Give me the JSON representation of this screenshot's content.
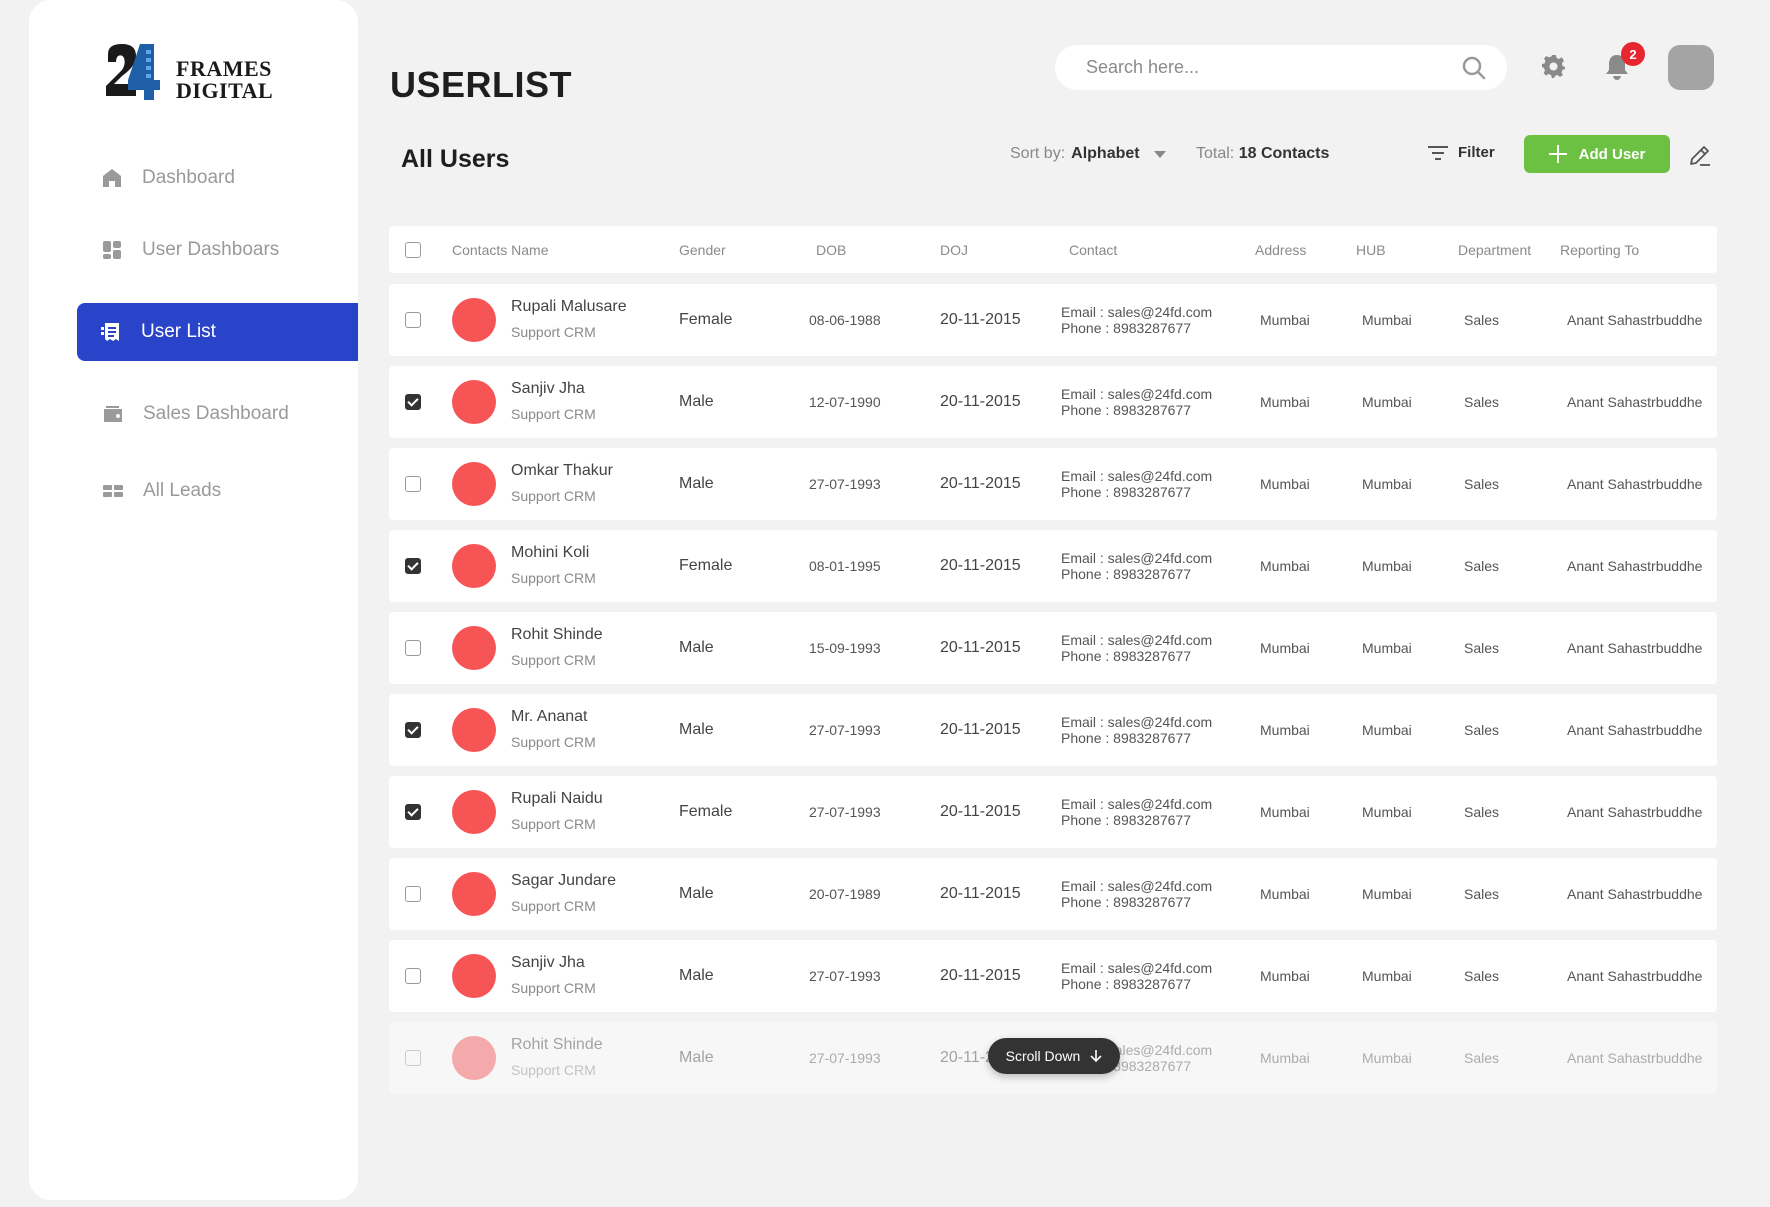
{
  "brand": {
    "line1": "FRAMES",
    "line2": "DIGITAL"
  },
  "sidebar": {
    "items": [
      {
        "label": "Dashboard",
        "icon": "home-icon",
        "active": false
      },
      {
        "label": "User Dashboars",
        "icon": "dashboard-icon",
        "active": false
      },
      {
        "label": "User List",
        "icon": "list-icon",
        "active": true
      },
      {
        "label": "Sales Dashboard",
        "icon": "wallet-icon",
        "active": false
      },
      {
        "label": "All Leads",
        "icon": "leads-icon",
        "active": false
      }
    ]
  },
  "header": {
    "title": "USERLIST",
    "search_placeholder": "Search here...",
    "notification_count": "2"
  },
  "toolbar": {
    "subtitle": "All Users",
    "sort_label": "Sort by:",
    "sort_value": "Alphabet",
    "total_label": "Total:",
    "total_value": "18 Contacts",
    "filter_label": "Filter",
    "add_label": "Add User"
  },
  "table": {
    "headers": [
      "Contacts Name",
      "Gender",
      "DOB",
      "DOJ",
      "Contact",
      "Address",
      "HUB",
      "Department",
      "Reporting To"
    ],
    "rows": [
      {
        "checked": false,
        "name": "Rupali Malusare",
        "role": "Support CRM",
        "gender": "Female",
        "dob": "08-06-1988",
        "doj": "20-11-2015",
        "email": "Email : sales@24fd.com",
        "phone": "Phone : 8983287677",
        "address": "Mumbai",
        "hub": "Mumbai",
        "department": "Sales",
        "reporting": "Anant Sahastrbuddhe"
      },
      {
        "checked": true,
        "name": "Sanjiv Jha",
        "role": "Support CRM",
        "gender": "Male",
        "dob": "12-07-1990",
        "doj": "20-11-2015",
        "email": "Email : sales@24fd.com",
        "phone": "Phone : 8983287677",
        "address": "Mumbai",
        "hub": "Mumbai",
        "department": "Sales",
        "reporting": "Anant Sahastrbuddhe"
      },
      {
        "checked": false,
        "name": "Omkar Thakur",
        "role": "Support CRM",
        "gender": "Male",
        "dob": "27-07-1993",
        "doj": "20-11-2015",
        "email": "Email : sales@24fd.com",
        "phone": "Phone : 8983287677",
        "address": "Mumbai",
        "hub": "Mumbai",
        "department": "Sales",
        "reporting": "Anant Sahastrbuddhe"
      },
      {
        "checked": true,
        "name": "Mohini Koli",
        "role": "Support CRM",
        "gender": "Female",
        "dob": "08-01-1995",
        "doj": "20-11-2015",
        "email": "Email : sales@24fd.com",
        "phone": "Phone : 8983287677",
        "address": "Mumbai",
        "hub": "Mumbai",
        "department": "Sales",
        "reporting": "Anant Sahastrbuddhe"
      },
      {
        "checked": false,
        "name": "Rohit Shinde",
        "role": "Support CRM",
        "gender": "Male",
        "dob": "15-09-1993",
        "doj": "20-11-2015",
        "email": "Email : sales@24fd.com",
        "phone": "Phone : 8983287677",
        "address": "Mumbai",
        "hub": "Mumbai",
        "department": "Sales",
        "reporting": "Anant Sahastrbuddhe"
      },
      {
        "checked": true,
        "name": "Mr. Ananat",
        "role": "Support CRM",
        "gender": "Male",
        "dob": "27-07-1993",
        "doj": "20-11-2015",
        "email": "Email : sales@24fd.com",
        "phone": "Phone : 8983287677",
        "address": "Mumbai",
        "hub": "Mumbai",
        "department": "Sales",
        "reporting": "Anant Sahastrbuddhe"
      },
      {
        "checked": true,
        "name": "Rupali Naidu",
        "role": "Support CRM",
        "gender": "Female",
        "dob": "27-07-1993",
        "doj": "20-11-2015",
        "email": "Email : sales@24fd.com",
        "phone": "Phone : 8983287677",
        "address": "Mumbai",
        "hub": "Mumbai",
        "department": "Sales",
        "reporting": "Anant Sahastrbuddhe"
      },
      {
        "checked": false,
        "name": "Sagar Jundare",
        "role": "Support CRM",
        "gender": "Male",
        "dob": "20-07-1989",
        "doj": "20-11-2015",
        "email": "Email : sales@24fd.com",
        "phone": "Phone : 8983287677",
        "address": "Mumbai",
        "hub": "Mumbai",
        "department": "Sales",
        "reporting": "Anant Sahastrbuddhe"
      },
      {
        "checked": false,
        "name": "Sanjiv Jha",
        "role": "Support CRM",
        "gender": "Male",
        "dob": "27-07-1993",
        "doj": "20-11-2015",
        "email": "Email : sales@24fd.com",
        "phone": "Phone : 8983287677",
        "address": "Mumbai",
        "hub": "Mumbai",
        "department": "Sales",
        "reporting": "Anant Sahastrbuddhe"
      },
      {
        "checked": false,
        "name": "Rohit Shinde",
        "role": "Support CRM",
        "gender": "Male",
        "dob": "27-07-1993",
        "doj": "20-11-2015",
        "email": "Email : sales@24fd.com",
        "phone": "Phone : 8983287677",
        "address": "Mumbai",
        "hub": "Mumbai",
        "department": "Sales",
        "reporting": "Anant Sahastrbuddhe",
        "faded": true
      }
    ]
  },
  "scroll_hint": "Scroll Down",
  "colors": {
    "accent": "#2a44c9",
    "add_button": "#6cc143",
    "avatar": "#f75555",
    "badge": "#e8262f"
  }
}
